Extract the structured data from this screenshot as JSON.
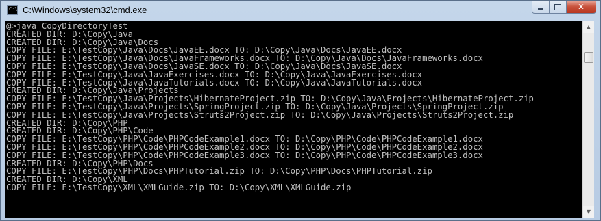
{
  "window": {
    "title": "C:\\Windows\\system32\\cmd.exe",
    "app_icon": "cmd-icon",
    "app_icon_glyph": "C:\\",
    "controls": {
      "minimize_icon": "minimize-icon",
      "maximize_icon": "maximize-icon",
      "close_icon": "close-icon",
      "close_glyph": "✕"
    }
  },
  "console": {
    "background": "#000000",
    "foreground": "#c0c0c0",
    "lines": [
      "@>java CopyDirectoryTest",
      "CREATED DIR: D:\\Copy\\Java",
      "CREATED DIR: D:\\Copy\\Java\\Docs",
      "COPY FILE: E:\\TestCopy\\Java\\Docs\\JavaEE.docx TO: D:\\Copy\\Java\\Docs\\JavaEE.docx",
      "COPY FILE: E:\\TestCopy\\Java\\Docs\\JavaFrameworks.docx TO: D:\\Copy\\Java\\Docs\\JavaFrameworks.docx",
      "COPY FILE: E:\\TestCopy\\Java\\Docs\\JavaSE.docx TO: D:\\Copy\\Java\\Docs\\JavaSE.docx",
      "COPY FILE: E:\\TestCopy\\Java\\JavaExercises.docx TO: D:\\Copy\\Java\\JavaExercises.docx",
      "COPY FILE: E:\\TestCopy\\Java\\JavaTutorials.docx TO: D:\\Copy\\Java\\JavaTutorials.docx",
      "CREATED DIR: D:\\Copy\\Java\\Projects",
      "COPY FILE: E:\\TestCopy\\Java\\Projects\\HibernateProject.zip TO: D:\\Copy\\Java\\Projects\\HibernateProject.zip",
      "COPY FILE: E:\\TestCopy\\Java\\Projects\\SpringProject.zip TO: D:\\Copy\\Java\\Projects\\SpringProject.zip",
      "COPY FILE: E:\\TestCopy\\Java\\Projects\\Struts2Project.zip TO: D:\\Copy\\Java\\Projects\\Struts2Project.zip",
      "CREATED DIR: D:\\Copy\\PHP",
      "CREATED DIR: D:\\Copy\\PHP\\Code",
      "COPY FILE: E:\\TestCopy\\PHP\\Code\\PHPCodeExample1.docx TO: D:\\Copy\\PHP\\Code\\PHPCodeExample1.docx",
      "COPY FILE: E:\\TestCopy\\PHP\\Code\\PHPCodeExample2.docx TO: D:\\Copy\\PHP\\Code\\PHPCodeExample2.docx",
      "COPY FILE: E:\\TestCopy\\PHP\\Code\\PHPCodeExample3.docx TO: D:\\Copy\\PHP\\Code\\PHPCodeExample3.docx",
      "CREATED DIR: D:\\Copy\\PHP\\Docs",
      "COPY FILE: E:\\TestCopy\\PHP\\Docs\\PHPTutorial.zip TO: D:\\Copy\\PHP\\Docs\\PHPTutorial.zip",
      "CREATED DIR: D:\\Copy\\XML",
      "COPY FILE: E:\\TestCopy\\XML\\XMLGuide.zip TO: D:\\Copy\\XML\\XMLGuide.zip"
    ]
  },
  "scrollbar": {
    "up_arrow": "▲",
    "down_arrow": "▼",
    "position": 0.12
  }
}
